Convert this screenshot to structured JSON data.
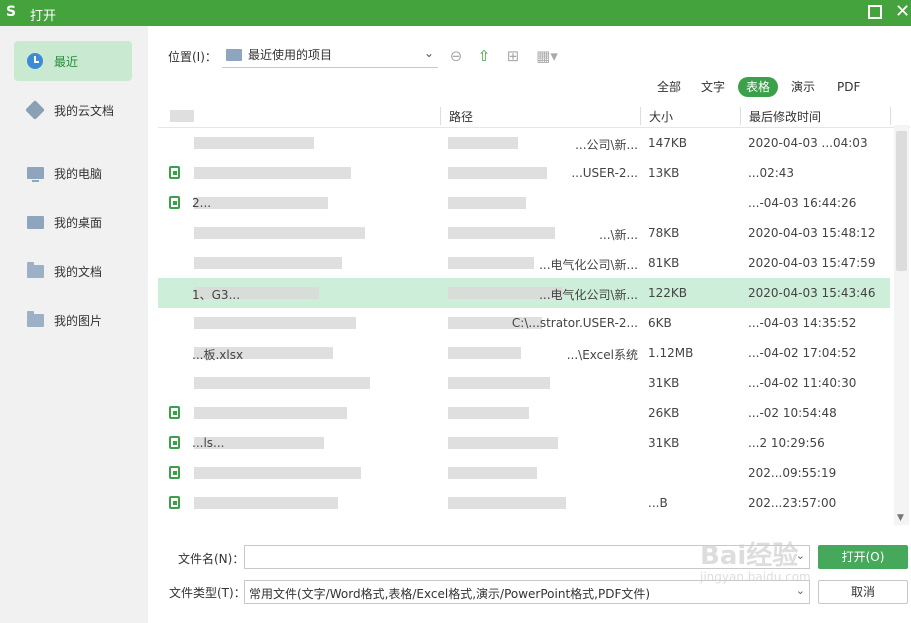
{
  "window": {
    "logo": "S",
    "title": "打开"
  },
  "sidebar": {
    "items": [
      {
        "label": "最近",
        "icon": "clock-icon",
        "active": true
      },
      {
        "label": "我的云文档",
        "icon": "cloud-cube-icon"
      },
      {
        "label": "我的电脑",
        "icon": "computer-icon"
      },
      {
        "label": "我的桌面",
        "icon": "desktop-icon"
      },
      {
        "label": "我的文档",
        "icon": "folder-icon"
      },
      {
        "label": "我的图片",
        "icon": "folder-icon"
      }
    ]
  },
  "location": {
    "label": "位置(I)：",
    "value": "最近使用的项目"
  },
  "filters": [
    "全部",
    "文字",
    "表格",
    "演示",
    "PDF"
  ],
  "active_filter": "表格",
  "columns": [
    "",
    "路径",
    "大小",
    "最后修改时间"
  ],
  "rows": [
    {
      "name": "",
      "path": "...公司\\新...",
      "size": "147KB",
      "modified": "2020-04-03 ...04:03"
    },
    {
      "name": "",
      "path": "...USER-2...",
      "size": "13KB",
      "modified": "...02:43"
    },
    {
      "name": "2...",
      "path": "",
      "size": "",
      "modified": "...-04-03 16:44:26"
    },
    {
      "name": "",
      "path": "...\\新...",
      "size": "78KB",
      "modified": "2020-04-03 15:48:12"
    },
    {
      "name": "",
      "path": "...电气化公司\\新...",
      "size": "81KB",
      "modified": "2020-04-03 15:47:59"
    },
    {
      "name": "1、G3...",
      "path": "...电气化公司\\新...",
      "size": "122KB",
      "modified": "2020-04-03 15:43:46"
    },
    {
      "name": "",
      "path": "C:\\...strator.USER-2...",
      "size": "6KB",
      "modified": "...-04-03 14:35:52"
    },
    {
      "name": "...板.xlsx",
      "path": "...\\Excel系统",
      "size": "1.12MB",
      "modified": "...-04-02 17:04:52"
    },
    {
      "name": "",
      "path": "",
      "size": "31KB",
      "modified": "...-04-02 11:40:30"
    },
    {
      "name": "",
      "path": "",
      "size": "26KB",
      "modified": "...-02 10:54:48"
    },
    {
      "name": "...ls...",
      "path": "",
      "size": "31KB",
      "modified": "...2 10:29:56"
    },
    {
      "name": "",
      "path": "",
      "size": "",
      "modified": "202...09:55:19"
    },
    {
      "name": "",
      "path": "",
      "size": "...B",
      "modified": "202...23:57:00"
    }
  ],
  "filename": {
    "label": "文件名(N)：",
    "value": ""
  },
  "filetype": {
    "label": "文件类型(T)：",
    "value": "常用文件(文字/Word格式,表格/Excel格式,演示/PowerPoint格式,PDF文件)"
  },
  "buttons": {
    "open": "打开(O)",
    "cancel": "取消"
  },
  "watermark": {
    "brand": "Bai经验",
    "url": "jingyan.baidu.com"
  }
}
